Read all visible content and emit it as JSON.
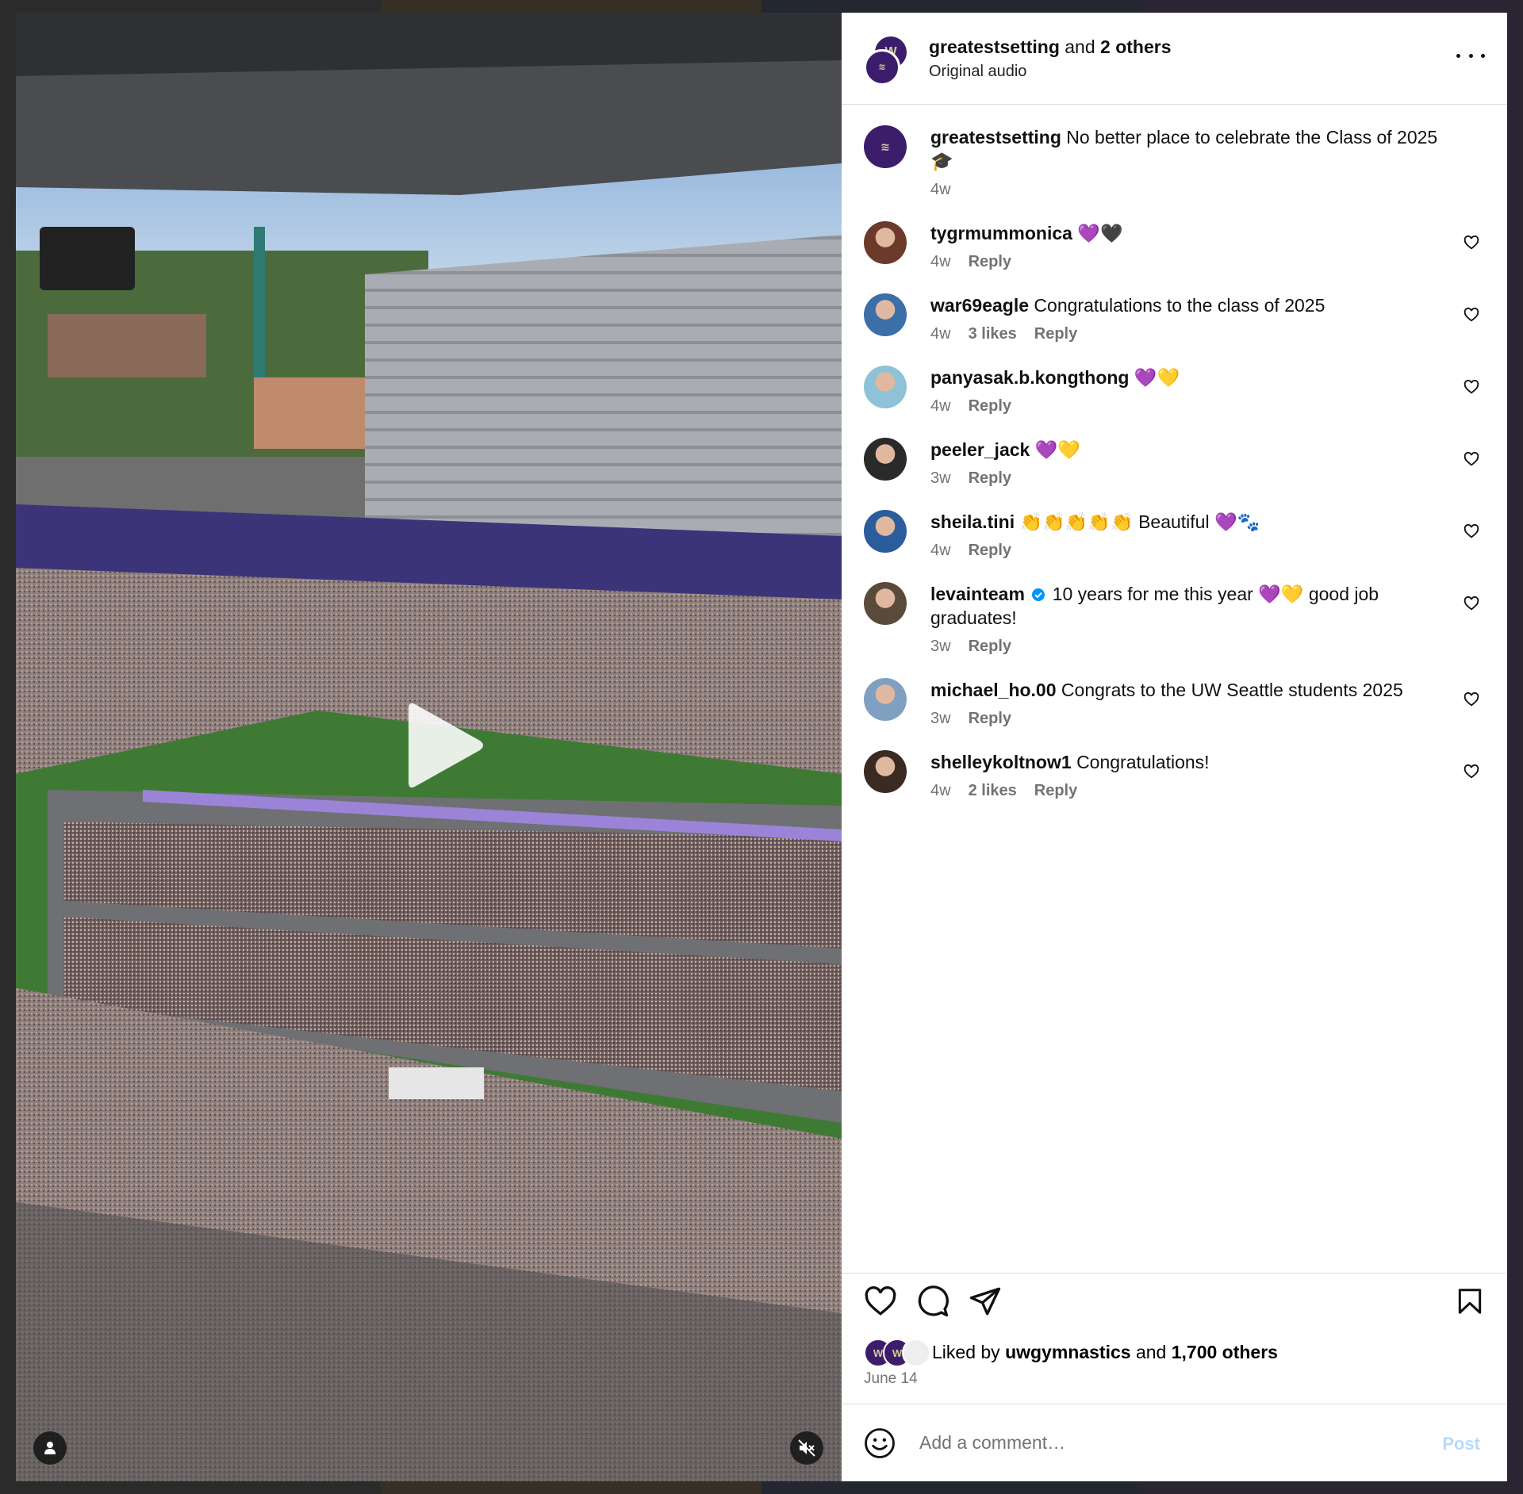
{
  "header": {
    "username": "greatestsetting",
    "and_text": "and",
    "others": "2 others",
    "audio": "Original audio"
  },
  "caption": {
    "username": "greatestsetting",
    "text": "No better place to celebrate the Class of 2025",
    "emoji": "🎓",
    "time": "4w"
  },
  "comments": [
    {
      "username": "tygrmummonica",
      "text": "",
      "emoji": "💜🖤",
      "time": "4w",
      "likes": "",
      "reply": "Reply",
      "avatar_color": "#6b3a2a"
    },
    {
      "username": "war69eagle",
      "text": "Congratulations to the class of 2025",
      "emoji": "",
      "time": "4w",
      "likes": "3 likes",
      "reply": "Reply",
      "avatar_color": "#3c6fa8"
    },
    {
      "username": "panyasak.b.kongthong",
      "text": "",
      "emoji": "💜💛",
      "time": "4w",
      "likes": "",
      "reply": "Reply",
      "avatar_color": "#8fc2d6"
    },
    {
      "username": "peeler_jack",
      "text": "",
      "emoji": "💜💛",
      "time": "3w",
      "likes": "",
      "reply": "Reply",
      "avatar_color": "#2a2a2a"
    },
    {
      "username": "sheila.tini",
      "text": "👏👏👏👏👏 Beautiful",
      "emoji": "💜🐾",
      "time": "4w",
      "likes": "",
      "reply": "Reply",
      "avatar_color": "#2b5d9c"
    },
    {
      "username": "levainteam",
      "text": "10 years for me this year 💜💛 good job graduates!",
      "emoji": "",
      "time": "3w",
      "likes": "",
      "reply": "Reply",
      "verified": true,
      "avatar_color": "#5a4a3a"
    },
    {
      "username": "michael_ho.00",
      "text": "Congrats to the UW Seattle students 2025",
      "emoji": "",
      "time": "3w",
      "likes": "",
      "reply": "Reply",
      "avatar_color": "#7fa0c0"
    },
    {
      "username": "shelleykoltnow1",
      "text": "Congratulations!",
      "emoji": "",
      "time": "4w",
      "likes": "2 likes",
      "reply": "Reply",
      "avatar_color": "#3a2a22"
    }
  ],
  "likes": {
    "prefix": "Liked by",
    "user": "uwgymnastics",
    "and_text": "and",
    "others": "1,700 others"
  },
  "date": "June 14",
  "comment_box": {
    "placeholder": "Add a comment…",
    "post_label": "Post"
  },
  "icons": {
    "play": "play-icon",
    "mute": "muted-speaker-icon",
    "user_tag": "person-icon",
    "more": "ellipsis-icon",
    "like": "heart-icon",
    "comment": "speech-bubble-icon",
    "share": "paper-plane-icon",
    "save": "bookmark-icon",
    "emoji": "smiley-icon"
  },
  "colors": {
    "uw_purple": "#3b1d6b",
    "link_disabled": "#b3dbff",
    "verified": "#0095f6"
  }
}
